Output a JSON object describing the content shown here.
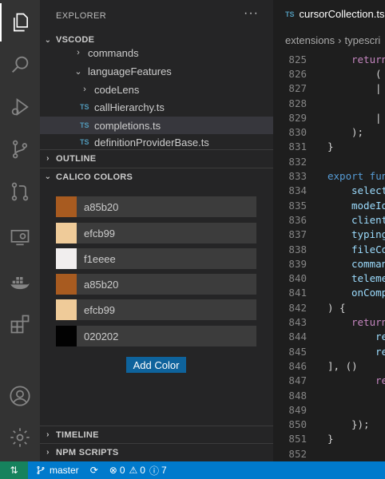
{
  "explorer": {
    "title": "EXPLORER",
    "more": "···",
    "workspace": "VSCODE",
    "tree": [
      {
        "label": "commands",
        "type": "folder",
        "expanded": false
      },
      {
        "label": "languageFeatures",
        "type": "folder",
        "expanded": true
      },
      {
        "label": "codeLens",
        "type": "folder",
        "expanded": false
      },
      {
        "label": "callHierarchy.ts",
        "type": "file",
        "badge": "TS"
      },
      {
        "label": "completions.ts",
        "type": "file",
        "badge": "TS",
        "selected": true
      },
      {
        "label": "definitionProviderBase.ts",
        "type": "file",
        "badge": "TS"
      }
    ],
    "outline": "OUTLINE",
    "calico": "CALICO COLORS",
    "timeline": "TIMELINE",
    "npm": "NPM SCRIPTS"
  },
  "colors": [
    {
      "label": "a85b20",
      "hex": "#a85b20"
    },
    {
      "label": "efcb99",
      "hex": "#efcb99"
    },
    {
      "label": "f1eeee",
      "hex": "#f1eeee"
    },
    {
      "label": "a85b20",
      "hex": "#a85b20"
    },
    {
      "label": "efcb99",
      "hex": "#efcb99"
    },
    {
      "label": "020202",
      "hex": "#020202"
    }
  ],
  "add_color_label": "Add Color",
  "editor": {
    "tab_badge": "TS",
    "tab_name": "cursorCollection.ts",
    "breadcrumb": [
      "extensions",
      "typescri"
    ],
    "lines": [
      {
        "n": "825",
        "text": "return",
        "color": "#c586c0",
        "indent": 2
      },
      {
        "n": "826",
        "text": "(",
        "color": "#d4d4d4",
        "indent": 4
      },
      {
        "n": "827",
        "text": "|",
        "color": "#d4d4d4",
        "indent": 4
      },
      {
        "n": "828",
        "text": "",
        "color": "#d4d4d4",
        "indent": 4
      },
      {
        "n": "829",
        "text": "|",
        "color": "#d4d4d4",
        "indent": 4
      },
      {
        "n": "830",
        "text": ");",
        "color": "#d4d4d4",
        "indent": 2
      },
      {
        "n": "831",
        "text": "}",
        "color": "#d4d4d4",
        "indent": 0
      },
      {
        "n": "832",
        "text": "",
        "color": "#d4d4d4",
        "indent": 0
      },
      {
        "n": "833",
        "text": "export fun",
        "color": "#569cd6",
        "indent": 0
      },
      {
        "n": "834",
        "text": "select",
        "color": "#9cdcfe",
        "indent": 2
      },
      {
        "n": "835",
        "text": "modeId",
        "color": "#9cdcfe",
        "indent": 2
      },
      {
        "n": "836",
        "text": "client",
        "color": "#9cdcfe",
        "indent": 2
      },
      {
        "n": "837",
        "text": "typing",
        "color": "#9cdcfe",
        "indent": 2
      },
      {
        "n": "838",
        "text": "fileCo",
        "color": "#9cdcfe",
        "indent": 2
      },
      {
        "n": "839",
        "text": "comman",
        "color": "#9cdcfe",
        "indent": 2
      },
      {
        "n": "840",
        "text": "teleme",
        "color": "#9cdcfe",
        "indent": 2
      },
      {
        "n": "841",
        "text": "onComp",
        "color": "#9cdcfe",
        "indent": 2
      },
      {
        "n": "842",
        "text": ") {",
        "color": "#d4d4d4",
        "indent": 0
      },
      {
        "n": "843",
        "text": "return",
        "color": "#c586c0",
        "indent": 2
      },
      {
        "n": "844",
        "text": "re",
        "color": "#9cdcfe",
        "indent": 4
      },
      {
        "n": "845",
        "text": "re",
        "color": "#9cdcfe",
        "indent": 4
      },
      {
        "n": "846",
        "text": "], ()",
        "color": "#d4d4d4",
        "indent": 0
      },
      {
        "n": "847",
        "text": "re",
        "color": "#c586c0",
        "indent": 4
      },
      {
        "n": "848",
        "text": "",
        "color": "#d4d4d4",
        "indent": 4
      },
      {
        "n": "849",
        "text": "",
        "color": "#d4d4d4",
        "indent": 4
      },
      {
        "n": "850",
        "text": "});",
        "color": "#d4d4d4",
        "indent": 2
      },
      {
        "n": "851",
        "text": "}",
        "color": "#d4d4d4",
        "indent": 0
      },
      {
        "n": "852",
        "text": "",
        "color": "#d4d4d4",
        "indent": 0
      }
    ]
  },
  "status": {
    "branch": "master",
    "errors": "0",
    "warnings": "0",
    "info": "7"
  }
}
